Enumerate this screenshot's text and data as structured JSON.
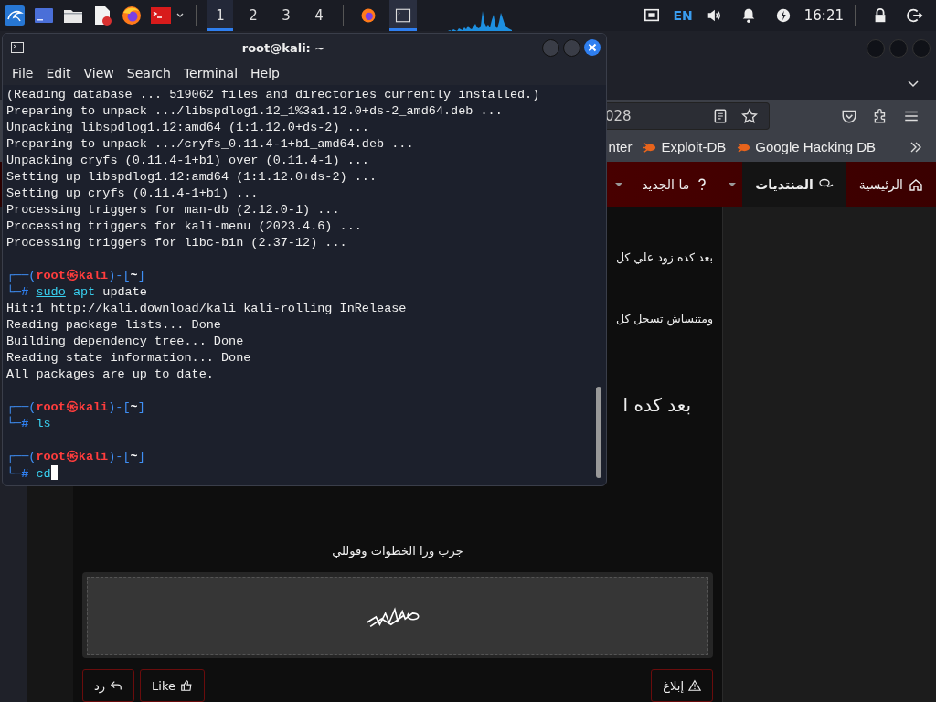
{
  "panel": {
    "launchers": [
      {
        "kind": "kali"
      },
      {
        "kind": "desktop"
      },
      {
        "kind": "files"
      },
      {
        "kind": "editor"
      },
      {
        "kind": "firefox"
      },
      {
        "kind": "terminal"
      }
    ],
    "workspaces": [
      {
        "label": "1",
        "selected": true
      },
      {
        "label": "2",
        "selected": false
      },
      {
        "label": "3",
        "selected": false
      },
      {
        "label": "4",
        "selected": false
      }
    ],
    "tasks": [
      {
        "kind": "firefox",
        "selected": false
      },
      {
        "kind": "terminal",
        "selected": true
      }
    ],
    "keyboard": "EN",
    "clock": "16:21"
  },
  "browser": {
    "url_tail": "028",
    "bookmarks": [
      {
        "label": "nter"
      },
      {
        "label": "Exploit-DB"
      },
      {
        "label": "Google Hacking DB"
      }
    ],
    "nav": [
      {
        "label": "الرئيسية",
        "kind": "home",
        "selected": false,
        "caret": false
      },
      {
        "label": "المنتديات",
        "kind": "chat",
        "selected": true,
        "caret": true
      },
      {
        "label": "ما الجديد",
        "kind": "question",
        "selected": false,
        "caret": true
      }
    ],
    "post": {
      "lines": [
        {
          "text": "بعد كده زود علي كل",
          "kind": "small"
        },
        {
          "text": "ومتنساش تسجل كل",
          "kind": "small"
        },
        {
          "text": "بعد كده ا",
          "kind": "large"
        },
        {
          "text": "جرب ورا الخطوات وقوللي",
          "kind": "center"
        }
      ],
      "actions_left": [
        {
          "label": "رد",
          "kind": "reply"
        },
        {
          "label": "Like",
          "kind": "like"
        }
      ],
      "actions_right": [
        {
          "label": "إبلاغ",
          "kind": "report"
        }
      ]
    }
  },
  "terminal": {
    "title": "root@kali: ~",
    "menu": [
      "File",
      "Edit",
      "View",
      "Search",
      "Terminal",
      "Help"
    ],
    "lines": [
      {
        "kind": "output",
        "text": "(Reading database ... 519062 files and directories currently installed.)"
      },
      {
        "kind": "output",
        "text": "Preparing to unpack .../libspdlog1.12_1%3a1.12.0+ds-2_amd64.deb ..."
      },
      {
        "kind": "output",
        "text": "Unpacking libspdlog1.12:amd64 (1:1.12.0+ds-2) ..."
      },
      {
        "kind": "output",
        "text": "Preparing to unpack .../cryfs_0.11.4-1+b1_amd64.deb ..."
      },
      {
        "kind": "output",
        "text": "Unpacking cryfs (0.11.4-1+b1) over (0.11.4-1) ..."
      },
      {
        "kind": "output",
        "text": "Setting up libspdlog1.12:amd64 (1:1.12.0+ds-2) ..."
      },
      {
        "kind": "output",
        "text": "Setting up cryfs (0.11.4-1+b1) ..."
      },
      {
        "kind": "output",
        "text": "Processing triggers for man-db (2.12.0-1) ..."
      },
      {
        "kind": "output",
        "text": "Processing triggers for kali-menu (2023.4.6) ..."
      },
      {
        "kind": "output",
        "text": "Processing triggers for libc-bin (2.37-12) ..."
      },
      {
        "kind": "blank"
      },
      {
        "kind": "prompt",
        "open": "┌──(",
        "user": "root㉿kali",
        "mid": ")-[",
        "dir": "~",
        "close": "]"
      },
      {
        "kind": "command",
        "lead": "└─",
        "hash": "#",
        "words": [
          {
            "text": "sudo",
            "kind": "sudo"
          },
          {
            "text": "apt",
            "kind": "program"
          },
          {
            "text": "update",
            "kind": "arg"
          }
        ]
      },
      {
        "kind": "output",
        "text": "Hit:1 http://kali.download/kali kali-rolling InRelease"
      },
      {
        "kind": "output",
        "text": "Reading package lists... Done"
      },
      {
        "kind": "output",
        "text": "Building dependency tree... Done"
      },
      {
        "kind": "output",
        "text": "Reading state information... Done"
      },
      {
        "kind": "output",
        "text": "All packages are up to date."
      },
      {
        "kind": "blank"
      },
      {
        "kind": "prompt",
        "open": "┌──(",
        "user": "root㉿kali",
        "mid": ")-[",
        "dir": "~",
        "close": "]"
      },
      {
        "kind": "command",
        "lead": "└─",
        "hash": "#",
        "words": [
          {
            "text": "ls",
            "kind": "program"
          }
        ]
      },
      {
        "kind": "blank"
      },
      {
        "kind": "prompt",
        "open": "┌──(",
        "user": "root㉿kali",
        "mid": ")-[",
        "dir": "~",
        "close": "]"
      },
      {
        "kind": "command",
        "lead": "└─",
        "hash": "#",
        "words": [
          {
            "text": "cd",
            "kind": "program"
          }
        ],
        "cursor": true
      }
    ]
  }
}
